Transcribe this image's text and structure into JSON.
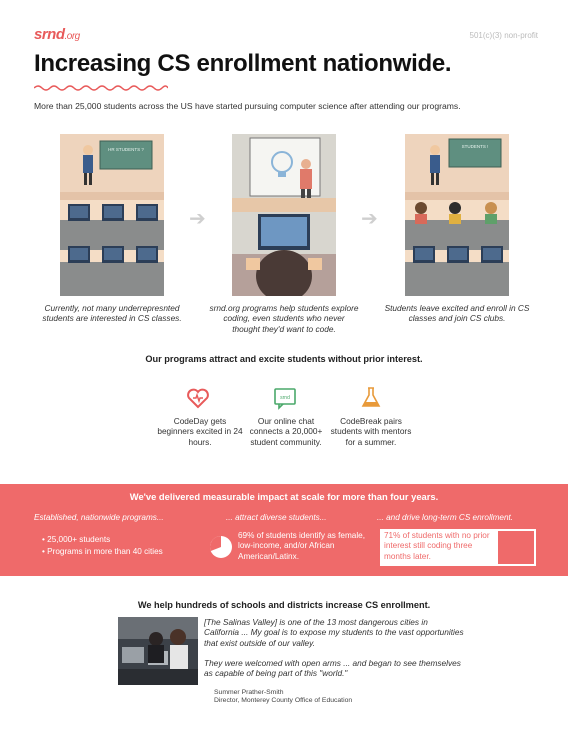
{
  "header": {
    "logo_main": "srnd",
    "logo_suffix": ".org",
    "tag": "501(c)(3) non-profit",
    "title": "Increasing CS enrollment nationwide.",
    "subtitle": "More than 25,000 students across the US have started pursuing computer science after attending our programs."
  },
  "panels": {
    "captions": [
      "Currently, not many underrepresnted students are interested in CS classes.",
      "srnd.org programs help students explore coding, even students who never thought they'd want to code.",
      "Students leave excited and enroll in CS classes and join CS clubs."
    ],
    "board_text_1": "HR STUDENTS ?",
    "board_text_3": "STUDENTS !"
  },
  "programs": {
    "heading": "Our programs attract and excite students without prior interest.",
    "items": [
      {
        "icon": "heart-icon",
        "text": "CodeDay gets beginners excited in 24 hours."
      },
      {
        "icon": "chat-icon",
        "icon_label": "srnd",
        "text": "Our online chat connects a 20,000+ student community."
      },
      {
        "icon": "flask-icon",
        "text": "CodeBreak pairs students with mentors for a summer."
      }
    ]
  },
  "impact": {
    "heading": "We've delivered measurable impact at scale for more than four years.",
    "col1_title": "Established, nationwide programs...",
    "col1_bullets": [
      "25,000+ students",
      "Programs in more than 40 cities"
    ],
    "col2_title": "... attract diverse students...",
    "col2_text": "69% of students identify as female, low-income, and/or African American/Latinx.",
    "pie_fraction": 0.69,
    "col3_title": "... and drive long-term CS enrollment.",
    "col3_text": "71% of students with no prior interest still coding three months later.",
    "bar_fraction": 0.71,
    "colors": {
      "band": "#ef6a6a",
      "accent": "#e85a5a"
    }
  },
  "testimonial": {
    "heading": "We help hundreds of schools and districts increase CS enrollment.",
    "quote_1": "[The Salinas Valley] is one of the 13 most dangerous cities in California ... My goal is to expose my students to the vast opportunities that exist outside of our valley.",
    "quote_2": "They were welcomed with open arms ... and began to see themselves as capable of being part of this \"world.\"",
    "name": "Summer Prather-Smith",
    "role": "Director, Monterey County Office of Education"
  }
}
